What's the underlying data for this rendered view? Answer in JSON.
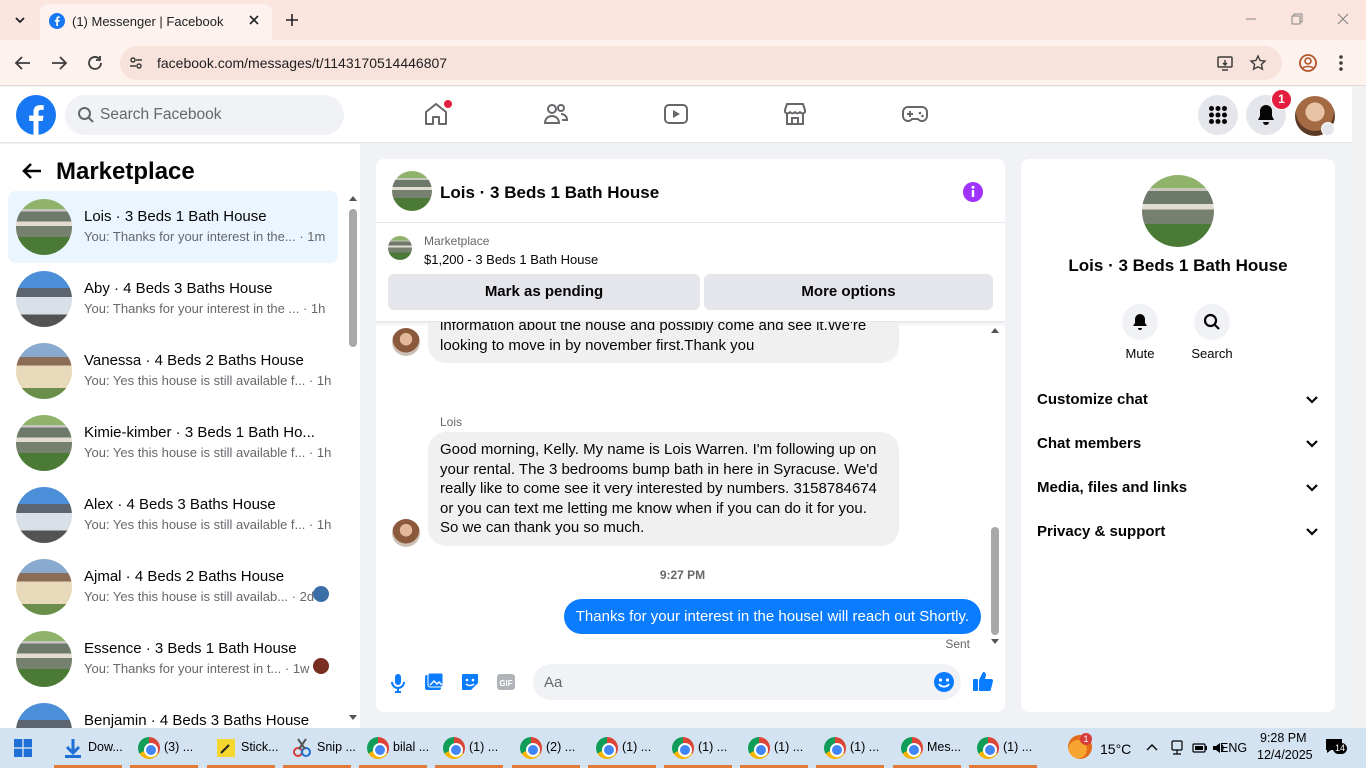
{
  "browser": {
    "tab_title": "(1) Messenger | Facebook",
    "url": "facebook.com/messages/t/1143170514446807",
    "accent": "#fbe5de"
  },
  "fb": {
    "search_placeholder": "Search Facebook",
    "notification_count": "1",
    "brand_color": "#1877f2"
  },
  "left": {
    "title": "Marketplace",
    "chats": [
      {
        "name": "Lois · 3 Beds 1 Bath House",
        "preview": "You: Thanks for your interest in the... · 1m",
        "avatar": "house-green",
        "active": true
      },
      {
        "name": "Aby · 4 Beds 3 Baths House",
        "preview": "You: Thanks for your interest in the ... · 1h",
        "avatar": "house-blue"
      },
      {
        "name": "Vanessa · 4 Beds 2 Baths House",
        "preview": "You: Yes this house is still available f... · 1h",
        "avatar": "house-cream"
      },
      {
        "name": "Kimie-kimber · 3 Beds 1 Bath Ho...",
        "preview": "You: Yes this house is still available f... · 1h",
        "avatar": "house-green"
      },
      {
        "name": "Alex · 4 Beds 3 Baths House",
        "preview": "You: Yes this house is still available f... · 1h",
        "avatar": "house-blue"
      },
      {
        "name": "Ajmal · 4 Beds 2 Baths House",
        "preview": "You: Yes this house is still availab... · 2d",
        "avatar": "house-cream",
        "mini": "#3b6fa8"
      },
      {
        "name": "Essence · 3 Beds 1 Bath House",
        "preview": "You: Thanks for your interest in t... · 1w",
        "avatar": "house-green",
        "mini": "#7a2e22"
      },
      {
        "name": "Benjamin · 4 Beds 3 Baths House",
        "preview": "",
        "avatar": "house-blue"
      }
    ]
  },
  "conversation": {
    "title": "Lois · 3 Beds 1 Bath House",
    "marketplace_label": "Marketplace",
    "listing": "$1,200 - 3 Beds 1 Bath House",
    "mark_pending": "Mark as pending",
    "more_options": "More options",
    "msg1_line1": "information about the house and possibly come and see it.We're",
    "msg1_line2": "looking to move in by november first.Thank you",
    "sender_name": "Lois",
    "msg2": "Good morning, Kelly. My name is Lois Warren. I'm following up on your rental. The 3 bedrooms bump bath in here in Syracuse. We'd really like to come see it very interested by numbers. 3158784674 or you can text me letting me know when if you can do it for you. So we can thank you so much.",
    "timestamp": "9:27 PM",
    "outgoing": "Thanks for your interest in the houseI will reach out Shortly.",
    "status": "Sent",
    "composer_placeholder": "Aa",
    "outgoing_color": "#0a7cff"
  },
  "details": {
    "name": "Lois · 3 Beds 1 Bath House",
    "mute": "Mute",
    "search": "Search",
    "sections": [
      "Customize chat",
      "Chat members",
      "Media, files and links",
      "Privacy & support"
    ]
  },
  "taskbar": {
    "items": [
      {
        "label": "Dow...",
        "icon": "download-icon"
      },
      {
        "label": "(3) ...",
        "icon": "chrome-icon"
      },
      {
        "label": "Stick...",
        "icon": "sticky-notes-icon"
      },
      {
        "label": "Snip ...",
        "icon": "snip-icon"
      },
      {
        "label": "bilal ...",
        "icon": "chrome-icon"
      },
      {
        "label": "(1) ...",
        "icon": "chrome-icon"
      },
      {
        "label": "(2) ...",
        "icon": "chrome-icon"
      },
      {
        "label": "(1) ...",
        "icon": "chrome-icon"
      },
      {
        "label": "(1) ...",
        "icon": "chrome-icon"
      },
      {
        "label": "(1) ...",
        "icon": "chrome-icon"
      },
      {
        "label": "(1) ...",
        "icon": "chrome-icon"
      },
      {
        "label": "Mes...",
        "icon": "chrome-icon"
      },
      {
        "label": "(1) ...",
        "icon": "chrome-icon"
      }
    ],
    "weather_badge": "1",
    "temperature": "15°C",
    "language": "ENG",
    "time": "9:28 PM",
    "date": "12/4/2025",
    "notifications": "14"
  }
}
